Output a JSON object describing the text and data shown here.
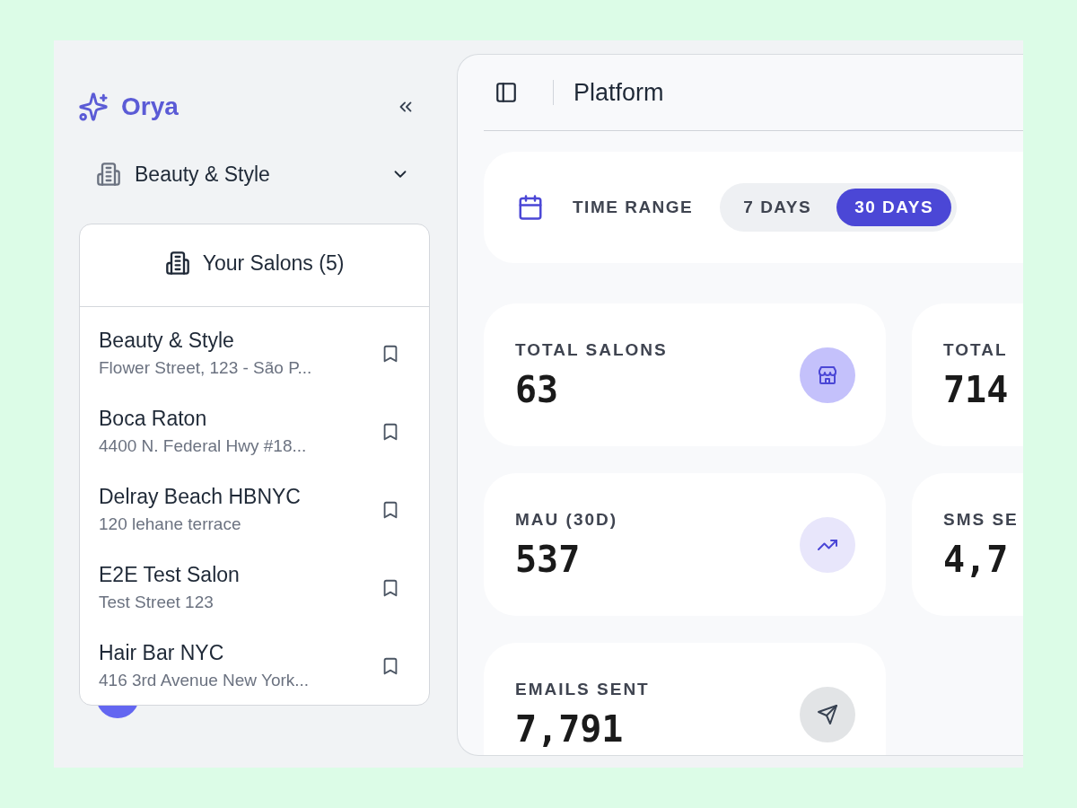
{
  "brand": {
    "name": "Orya"
  },
  "sidebar": {
    "current_salon": "Beauty & Style"
  },
  "salon_menu": {
    "title": "Your Salons (5)",
    "items": [
      {
        "name": "Beauty & Style",
        "address": "Flower Street, 123 - São P..."
      },
      {
        "name": "Boca Raton",
        "address": "4400 N. Federal Hwy #18..."
      },
      {
        "name": "Delray Beach HBNYC",
        "address": "120 lehane terrace"
      },
      {
        "name": "E2E Test Salon",
        "address": "Test Street 123"
      },
      {
        "name": "Hair Bar NYC",
        "address": "416 3rd Avenue New York..."
      }
    ]
  },
  "header": {
    "title": "Platform"
  },
  "time_range": {
    "label": "TIME RANGE",
    "options": [
      {
        "label": "7 DAYS",
        "selected": false
      },
      {
        "label": "30 DAYS",
        "selected": true
      }
    ]
  },
  "stats": [
    {
      "label": "TOTAL SALONS",
      "value": "63",
      "kind": "store"
    },
    {
      "label": "TOTAL",
      "value": "714"
    },
    {
      "label": "MAU (30D)",
      "value": "537",
      "kind": "trend"
    },
    {
      "label": "SMS SE",
      "value": "4,7"
    },
    {
      "label": "EMAILS SENT",
      "value": "7,791",
      "kind": "send"
    }
  ]
}
